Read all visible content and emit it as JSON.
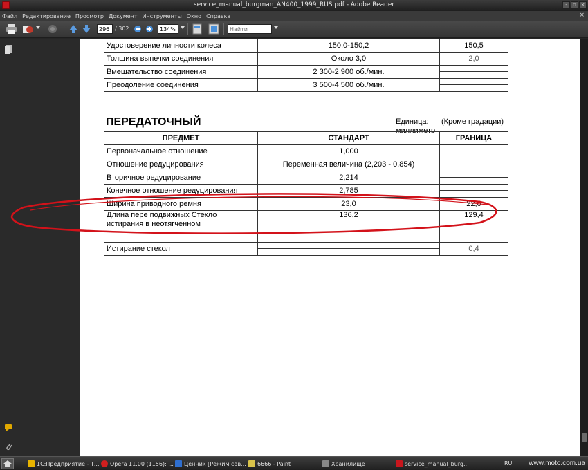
{
  "window": {
    "title": "service_manual_burgman_AN400_1999_RUS.pdf - Adobe Reader",
    "min_label": "-",
    "max_label": "▫",
    "close_label": "×"
  },
  "menu": {
    "items": [
      "Файл",
      "Редактирование",
      "Просмотр",
      "Документ",
      "Инструменты",
      "Окно",
      "Справка"
    ],
    "close_doc": "×"
  },
  "toolbar": {
    "page_current": "296",
    "page_total": "/ 302",
    "zoom": "134%",
    "find_placeholder": "Найти"
  },
  "document": {
    "table1": {
      "rows": [
        {
          "item": "Удостоверение личности колеса",
          "standard": "150,0-150,2",
          "limit": "150,5"
        },
        {
          "item": "Толщина выпечки соединения",
          "standard": "Около 3,0",
          "limit": "2,0"
        },
        {
          "item": "Вмешательство соединения",
          "standard": "2 300-2 900 об./мин.",
          "limit": ""
        },
        {
          "item": "Преодоление соединения",
          "standard": "3 500-4 500 об./мин.",
          "limit": ""
        }
      ]
    },
    "section_title": "ПЕРЕДАТОЧНЫЙ",
    "unit_label": "Единица: миллиметр",
    "grad_label": "(Кроме градации)",
    "table2": {
      "headers": {
        "item": "ПРЕДМЕТ",
        "standard": "СТАНДАРТ",
        "limit": "ГРАНИЦА"
      },
      "rows": [
        {
          "item": "Первоначальное отношение",
          "standard": "1,000",
          "limit": ""
        },
        {
          "item": "Отношение редуцирования",
          "standard": "Переменная величина (2,203 - 0,854)",
          "limit": ""
        },
        {
          "item": "Вторичное редуцирование",
          "standard": "2,214",
          "limit": ""
        },
        {
          "item": "Конечное отношение редуцирования",
          "standard": "2,785",
          "limit": ""
        },
        {
          "item": "Ширина приводного ремня",
          "standard": "23,0",
          "limit": "22,0"
        },
        {
          "item": "Длина пере подвижных Стекло истирания в неотягченном",
          "standard": "136,2",
          "limit": "129,4"
        },
        {
          "item": "Истирание стекол",
          "standard": "",
          "limit": "0,4"
        }
      ]
    }
  },
  "taskbar": {
    "tasks": [
      {
        "label": "1С:Предприятие - Т...",
        "color": "#e8b400"
      },
      {
        "label": "Opera 11.00 (1156): ...",
        "color": "#d21f1f"
      },
      {
        "label": "Ценник [Режим сов...",
        "color": "#2f6fd0"
      },
      {
        "label": "6666 - Paint",
        "color": "#d8c24a"
      },
      {
        "label": "Хранилище",
        "color": "#888888"
      },
      {
        "label": "service_manual_burg...",
        "color": "#c8161d"
      }
    ],
    "lang": "RU",
    "watermark": "www.moto.com.ua"
  },
  "colors": {
    "annotation_ellipse": "#d3121a",
    "accent_reader": "#c8161d"
  }
}
